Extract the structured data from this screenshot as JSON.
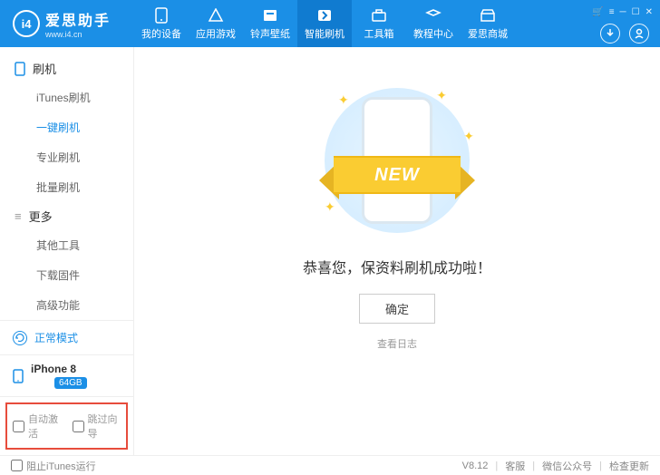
{
  "logo": {
    "badge": "i4",
    "name": "爱思助手",
    "url": "www.i4.cn"
  },
  "nav": [
    {
      "label": "我的设备"
    },
    {
      "label": "应用游戏"
    },
    {
      "label": "铃声壁纸"
    },
    {
      "label": "智能刷机"
    },
    {
      "label": "工具箱"
    },
    {
      "label": "教程中心"
    },
    {
      "label": "爱思商城"
    }
  ],
  "sidebar": {
    "group1": "刷机",
    "items1": [
      "iTunes刷机",
      "一键刷机",
      "专业刷机",
      "批量刷机"
    ],
    "group2": "更多",
    "items2": [
      "其他工具",
      "下载固件",
      "高级功能"
    ],
    "mode": "正常模式",
    "device": {
      "name": "iPhone 8",
      "storage": "64GB"
    },
    "check_auto": "自动激活",
    "check_skip": "跳过向导"
  },
  "main": {
    "ribbon": "NEW",
    "success": "恭喜您，保资料刷机成功啦！",
    "ok": "确定",
    "log": "查看日志"
  },
  "footer": {
    "block_itunes": "阻止iTunes运行",
    "version": "V8.12",
    "links": [
      "客服",
      "微信公众号",
      "检查更新"
    ]
  }
}
